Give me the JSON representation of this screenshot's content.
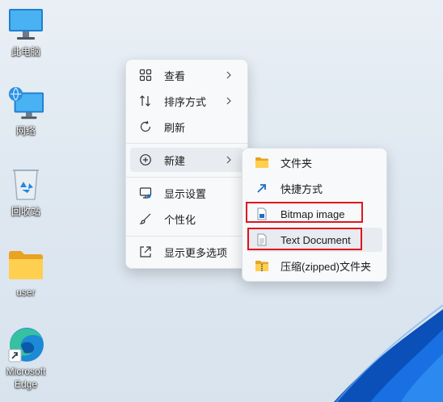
{
  "desktop": {
    "icons": [
      {
        "label": "此电脑",
        "icon": "computer-icon"
      },
      {
        "label": "网络",
        "icon": "network-icon"
      },
      {
        "label": "回收站",
        "icon": "recycle-bin-icon"
      },
      {
        "label": "user",
        "icon": "folder-icon"
      },
      {
        "label": "Microsoft Edge",
        "line1": "Microsoft",
        "line2": "Edge",
        "icon": "edge-icon"
      }
    ]
  },
  "context_menu": {
    "items": [
      {
        "label": "查看",
        "icon": "grid-view-icon",
        "has_submenu": true
      },
      {
        "label": "排序方式",
        "icon": "sort-icon",
        "has_submenu": true
      },
      {
        "label": "刷新",
        "icon": "refresh-icon",
        "has_submenu": false
      },
      {
        "label": "新建",
        "icon": "new-plus-icon",
        "has_submenu": true,
        "highlighted": true
      },
      {
        "label": "显示设置",
        "icon": "display-settings-icon",
        "has_submenu": false
      },
      {
        "label": "个性化",
        "icon": "brush-icon",
        "has_submenu": false
      },
      {
        "label": "显示更多选项",
        "icon": "more-options-icon",
        "has_submenu": false
      }
    ]
  },
  "new_submenu": {
    "items": [
      {
        "label": "文件夹",
        "icon": "folder-icon"
      },
      {
        "label": "快捷方式",
        "icon": "shortcut-icon"
      },
      {
        "label": "Bitmap image",
        "icon": "bitmap-icon",
        "boxed": true
      },
      {
        "label": "Text Document",
        "icon": "text-document-icon",
        "boxed": true,
        "highlighted": true
      },
      {
        "label": "压缩(zipped)文件夹",
        "icon": "zip-folder-icon"
      }
    ]
  },
  "colors": {
    "accent": "#0067c0",
    "highlight_box": "#e2141c",
    "menu_bg": "#f7f9fb"
  }
}
